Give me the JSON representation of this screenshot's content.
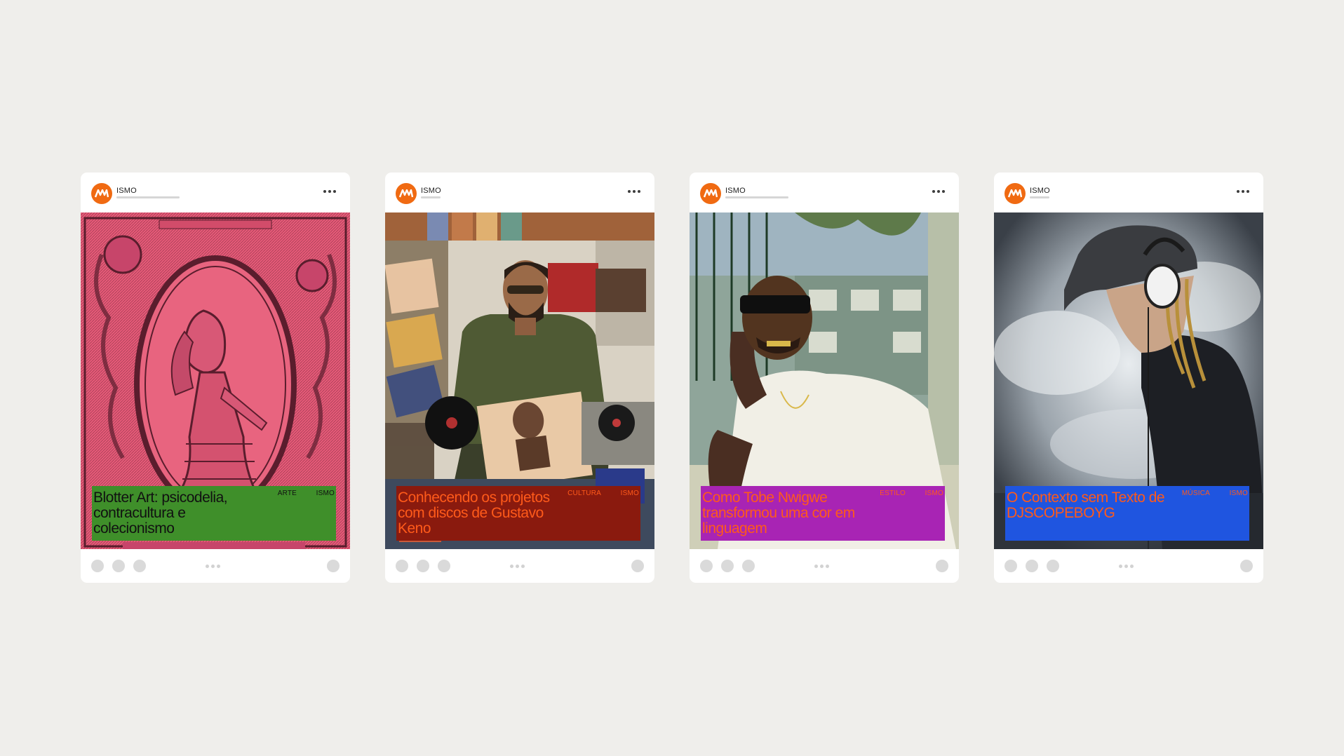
{
  "posts": [
    {
      "username": "ISMO",
      "title": "Blotter Art: psicodelia, contracultura e colecionismo",
      "category": "ARTE",
      "brand": "ISMO",
      "caption_bg": "#3f8f2a",
      "caption_text": "#111111",
      "tag_color": "#111111",
      "image": "psychedelic-illustration"
    },
    {
      "username": "ISMO",
      "title": "Conhecendo os projetos com discos de Gustavo Keno",
      "category": "CULTURA",
      "brand": "ISMO",
      "caption_bg": "#8a1a0e",
      "caption_text": "#ff5a1a",
      "tag_color": "#ff5a1a",
      "image": "record-store-photo"
    },
    {
      "username": "ISMO",
      "title": "Como Tobe Nwigwe transformou uma cor em linguagem",
      "category": "ESTILO",
      "brand": "ISMO",
      "caption_bg": "#a824b4",
      "caption_text": "#ff5a1a",
      "tag_color": "#ff5a1a",
      "image": "portrait-photo"
    },
    {
      "username": "ISMO",
      "title": "O Contexto sem Texto de DJSCOPEBOYG",
      "category": "MÚSICA",
      "brand": "ISMO",
      "caption_bg": "#1f55e0",
      "caption_text": "#ff5a1a",
      "tag_color": "#ff5a1a",
      "image": "dj-photo"
    }
  ],
  "colors": {
    "background": "#efeeeb",
    "brand_orange": "#f06a12",
    "card": "#ffffff"
  },
  "icons": {
    "avatar": "ismo-logo-icon",
    "menu": "more-dots-icon"
  }
}
